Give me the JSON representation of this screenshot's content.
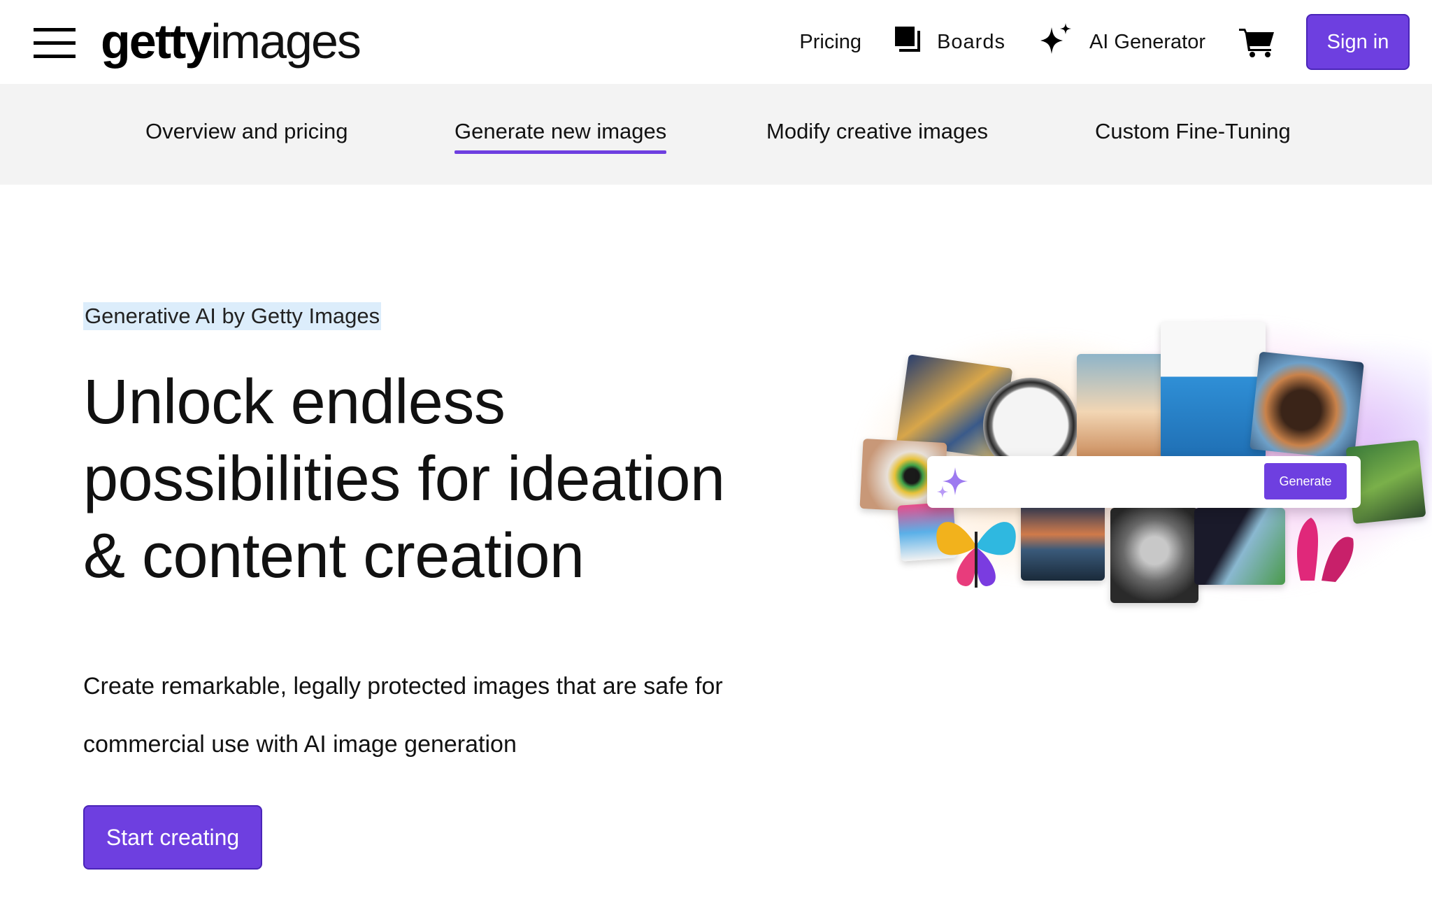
{
  "header": {
    "logo": {
      "bold": "getty",
      "light": "images"
    },
    "nav": {
      "pricing": "Pricing",
      "boards": "Boards",
      "ai_generator": "AI Generator",
      "sign_in": "Sign in"
    },
    "icons": [
      "menu-icon",
      "boards-icon",
      "sparkle-icon",
      "cart-icon"
    ]
  },
  "subnav": {
    "items": [
      {
        "label": "Overview and pricing",
        "active": false
      },
      {
        "label": "Generate new images",
        "active": true
      },
      {
        "label": "Modify creative images",
        "active": false
      },
      {
        "label": "Custom Fine-Tuning",
        "active": false
      }
    ]
  },
  "hero": {
    "eyebrow": "Generative AI by Getty Images",
    "headline_lines": [
      "Unlock endless",
      "possibilities for ideation",
      "& content creation"
    ],
    "description_lines": [
      "Create remarkable, legally protected images that are safe for",
      "commercial use with AI image generation"
    ],
    "cta": "Start creating"
  },
  "collage": {
    "generate_button": "Generate"
  },
  "colors": {
    "accent": "#6e3fe0",
    "subnav_bg": "#f3f3f3",
    "eyebrow_highlight": "#dcedfb"
  }
}
